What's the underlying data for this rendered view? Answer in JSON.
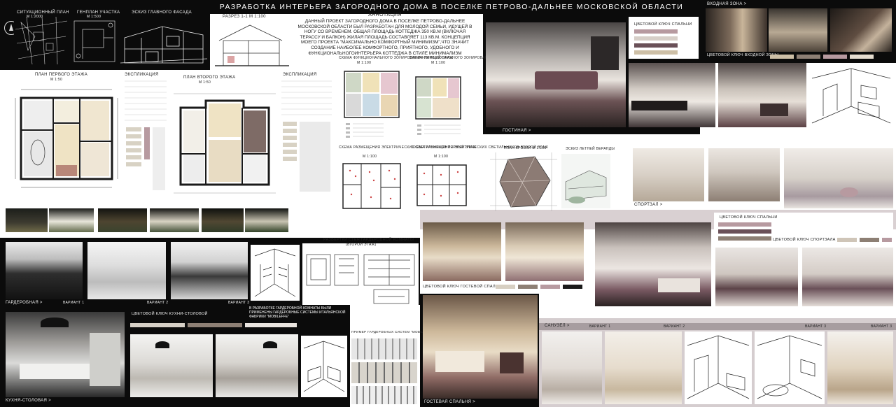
{
  "title": "РАЗРАБОТКА ИНТЕРЬЕРА ЗАГОРОДНОГО ДОМА В ПОСЕЛКЕ ПЕТРОВО-ДАЛЬНЕЕ МОСКОВСКОЙ ОБЛАСТИ",
  "annotation": {
    "heading": "АННОТАЦИЯ",
    "text": "ДАННЫЙ ПРОЕКТ ЗАГОРОДНОГО ДОМА В ПОСЕЛКЕ ПЕТРОВО-ДАЛЬНЕЕ МОСКОВСКОЙ ОБЛАСТИ БЫЛ РАЗРАБОТАН ДЛЯ МОЛОДОЙ СЕМЬИ, ИДУЩЕЙ В НОГУ СО ВРЕМЕНЕМ. ОБЩАЯ ПЛОЩАДЬ КОТТЕДЖА 350 КВ.М (ВКЛЮЧАЯ ТЕРАССУ И БАЛКОН) ЖИЛАЯ ПЛОЩАДЬ СОСТАВЛЯЕТ 113 КВ.М. КОНЦЕПЦИЯ МОЕГО ПРОЕКТА \"МАКСИМАЛЬНО КОМФОРТНЫЙ МИНИМИЗМ\",ЧТО ЗНАЧИТ СОЗДАНИЕ НАИБОЛЕЕ КОМФОРТНОГО, ПРИЯТНОГО, УДОБНОГО И ФУНКЦИОНАЛЬНОГОИНТЕРЬЕРА КОТТЕДЖА В СТИЛЕ МИНИМАЛИЗМ"
  },
  "top_labels": {
    "site_plan": "СИТУАЦИОННЫЙ ПЛАН",
    "site_plan_scale": "М 1:2000",
    "lot_plan": "ГЕНПЛАН УЧАСТКА",
    "lot_plan_scale": "М 1:500",
    "facade": "ЭСКИЗ ГЛАВНОГО ФАСАДА",
    "section": "РАЗРЕЗ 1-1 М 1:100"
  },
  "plans": {
    "first_floor": "ПЛАН ПЕРВОГО ЭТАЖА",
    "first_scale": "М 1:50",
    "second_floor": "ПЛАН ВТОРОГО ЭТАЖА",
    "second_scale": "М 1:50",
    "explication": "ЭКСПЛИКАЦИЯ",
    "explication2": "ЭКСПЛИКАЦИЯ",
    "zoning1": "СХЕМА ФУНКЦИОНАЛЬНОГО ЗОНИРОВАНИЯ ПЕРВЫЙ ЭТАЖ",
    "zoning1_scale": "М 1:100",
    "zoning2": "СХЕМА ФУНКЦИОНАЛЬНОГО ЗОНИРОВАНИЯ ВТОРОЙ ЭТАЖ",
    "zoning2_scale": "М 1:100",
    "lights1": "СХЕМА РАЗМЕЩЕНИЯ ЭЛЕКТРИЧЕСКИХ СВЕТИЛЬНИКОВ ПЕРВЫЙ ЭТАЖ",
    "lights1_scale": "М 1:100",
    "lights2": "СХЕМА РАЗМЕЩЕНИЯ ЭЛЕКТРИЧЕСКИХ СВЕТИЛЬНИКОВ ВТОРОЙ ЭТАЖ",
    "lights2_scale": "М 1:100",
    "roof": "ПЛАН КРОВЛИ М 1:100",
    "veranda": "ЭСКИЗ ЛЕТНЕЙ ВЕРАНДЫ"
  },
  "sections": {
    "entrance": "ВХОДНАЯ ЗОНА >",
    "living": "ГОСТИНАЯ >",
    "gym": "СПОРТЗАЛ >",
    "wardrobe": "ГАРДЕРОБНАЯ >",
    "kitchen": "КУХНЯ-СТОЛОВАЯ >",
    "guest": "ГОСТЕВАЯ СПАЛЬНЯ >",
    "bathroom": "САНУЗЕЛ >"
  },
  "variants": {
    "v1": "ВАРИАНТ 1",
    "v2": "ВАРИАНТ 2",
    "v3": "ВАРИАНТ 3"
  },
  "color_keys": {
    "bedroom": "ЦВЕТОВОЙ КЛЮЧ СПАЛЬНИ",
    "entrance": "ЦВЕТОВОЙ КЛЮЧ ВХОДНОЙ ЗОНЫ",
    "bedroom2": "ЦВЕТОВОЙ КЛЮЧ СПАЛЬНИ",
    "gym": "ЦВЕТОВОЙ КЛЮЧ СПОРТЗАЛА",
    "guest": "ЦВЕТОВОЙ КЛЮЧ ГОСТЕВОЙ СПАЛЬНИ",
    "kitchen": "ЦВЕТОВОЙ КЛЮЧ КУХНИ-СТОЛОВОЙ"
  },
  "wardrobe": {
    "walls_title": "РАЗВЕРТКИ СТЕН ГАРДЕРОБНОЙ КОМНАТЫ",
    "walls_sub": "(ВТОРОЙ ЭТАЖ)",
    "note": "В РАЗРАБОТКЕ ГАРДЕРОБНОЙ КОМНАТЫ БЫЛИ ПРИМЕНЕНЫ ГАРДЕРОБНЫЕ СИСТЕМЫ ИТАЛЬЯНСКОЙ ФАБРИКИ \"MOBILEFFE\"",
    "example": "ПРИМЕР ГАРДЕРОБНЫХ СИСТЕМ \"MOBILEFFE\""
  },
  "palette": {
    "mauve": "#b79aa0",
    "plum": "#6a5058",
    "taupe": "#8d7f74",
    "sand": "#cdbfa6",
    "dark": "#1a1a1a",
    "board_black": "#0b0b0b"
  }
}
